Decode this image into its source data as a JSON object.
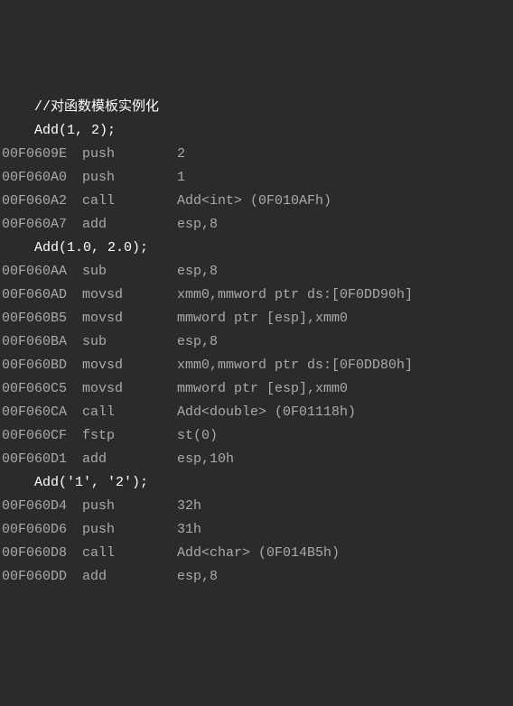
{
  "lines": [
    {
      "type": "source",
      "indent_class": "indent-src",
      "text": "//对函数模板实例化"
    },
    {
      "type": "source",
      "indent_class": "indent-src",
      "text": "Add(1, 2);"
    },
    {
      "type": "asm",
      "addr": "00F0609E",
      "mnemonic": "push",
      "operands": "2"
    },
    {
      "type": "asm",
      "addr": "00F060A0",
      "mnemonic": "push",
      "operands": "1"
    },
    {
      "type": "asm",
      "addr": "00F060A2",
      "mnemonic": "call",
      "operands": "Add<int> (0F010AFh)"
    },
    {
      "type": "asm",
      "addr": "00F060A7",
      "mnemonic": "add",
      "operands": "esp,8"
    },
    {
      "type": "source",
      "indent_class": "indent-src",
      "text": "Add(1.0, 2.0);"
    },
    {
      "type": "asm",
      "addr": "00F060AA",
      "mnemonic": "sub",
      "operands": "esp,8"
    },
    {
      "type": "asm",
      "addr": "00F060AD",
      "mnemonic": "movsd",
      "operands": "xmm0,mmword ptr ds:[0F0DD90h]"
    },
    {
      "type": "asm",
      "addr": "00F060B5",
      "mnemonic": "movsd",
      "operands": "mmword ptr [esp],xmm0"
    },
    {
      "type": "asm",
      "addr": "00F060BA",
      "mnemonic": "sub",
      "operands": "esp,8"
    },
    {
      "type": "asm",
      "addr": "00F060BD",
      "mnemonic": "movsd",
      "operands": "xmm0,mmword ptr ds:[0F0DD80h]"
    },
    {
      "type": "asm",
      "addr": "00F060C5",
      "mnemonic": "movsd",
      "operands": "mmword ptr [esp],xmm0"
    },
    {
      "type": "asm",
      "addr": "00F060CA",
      "mnemonic": "call",
      "operands": "Add<double> (0F01118h)"
    },
    {
      "type": "asm",
      "addr": "00F060CF",
      "mnemonic": "fstp",
      "operands": "st(0)"
    },
    {
      "type": "asm",
      "addr": "00F060D1",
      "mnemonic": "add",
      "operands": "esp,10h"
    },
    {
      "type": "source",
      "indent_class": "indent-src",
      "text": "Add('1', '2');"
    },
    {
      "type": "asm",
      "addr": "00F060D4",
      "mnemonic": "push",
      "operands": "32h"
    },
    {
      "type": "asm",
      "addr": "00F060D6",
      "mnemonic": "push",
      "operands": "31h"
    },
    {
      "type": "asm",
      "addr": "00F060D8",
      "mnemonic": "call",
      "operands": "Add<char> (0F014B5h)"
    },
    {
      "type": "asm",
      "addr": "00F060DD",
      "mnemonic": "add",
      "operands": "esp,8"
    }
  ]
}
